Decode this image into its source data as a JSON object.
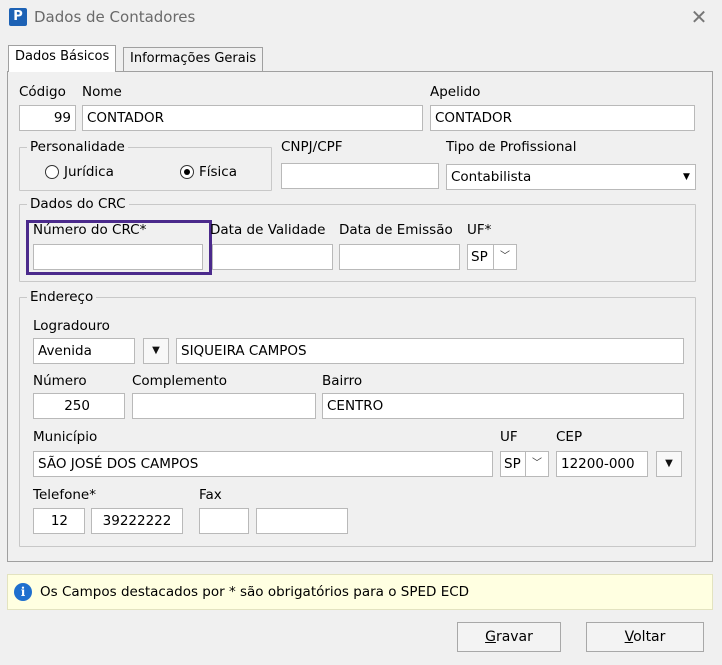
{
  "window": {
    "title": "Dados de Contadores",
    "icon_letter": "P",
    "close_glyph": "✕"
  },
  "tabs": [
    {
      "label": "Dados Básicos"
    },
    {
      "label": "Informações Gerais"
    }
  ],
  "fields": {
    "codigo": {
      "label": "Código",
      "value": "99"
    },
    "nome": {
      "label": "Nome",
      "value": "CONTADOR"
    },
    "apelido": {
      "label": "Apelido",
      "value": "CONTADOR"
    },
    "personalidade": {
      "title": "Personalidade",
      "option_juridica": "Jurídica",
      "option_fisica": "Física",
      "selected": "Física"
    },
    "cnpj": {
      "label": "CNPJ/CPF",
      "value": ""
    },
    "tipo": {
      "label": "Tipo de Profissional",
      "value": "Contabilista"
    },
    "crc": {
      "title": "Dados do CRC",
      "numero_label": "Número do CRC*",
      "validade_label": "Data de Validade",
      "emissao_label": "Data de Emissão",
      "uf_label": "UF*",
      "uf_value": "SP"
    },
    "endereco": {
      "title": "Endereço",
      "logradouro_label": "Logradouro",
      "logradouro_tipo": "Avenida",
      "logradouro_value": "SIQUEIRA CAMPOS",
      "numero_label": "Número",
      "numero_value": "250",
      "complemento_label": "Complemento",
      "complemento_value": "",
      "bairro_label": "Bairro",
      "bairro_value": "CENTRO",
      "municipio_label": "Município",
      "municipio_value": "SÃO JOSÉ DOS CAMPOS",
      "uf_label": "UF",
      "uf_value": "SP",
      "cep_label": "CEP",
      "cep_value": "12200-000",
      "telefone_label": "Telefone*",
      "telefone_ddd": "12",
      "telefone_num": "39222222",
      "fax_label": "Fax"
    }
  },
  "info": {
    "text": "Os Campos destacados por * são obrigatórios para o SPED ECD"
  },
  "buttons": {
    "gravar": {
      "hotkey": "G",
      "rest": "ravar"
    },
    "voltar": {
      "hotkey": "V",
      "rest": "oltar"
    }
  },
  "colors": {
    "highlight": "#4b2a8c",
    "info_bg": "#ffffe1",
    "app_icon": "#1d62b5"
  }
}
